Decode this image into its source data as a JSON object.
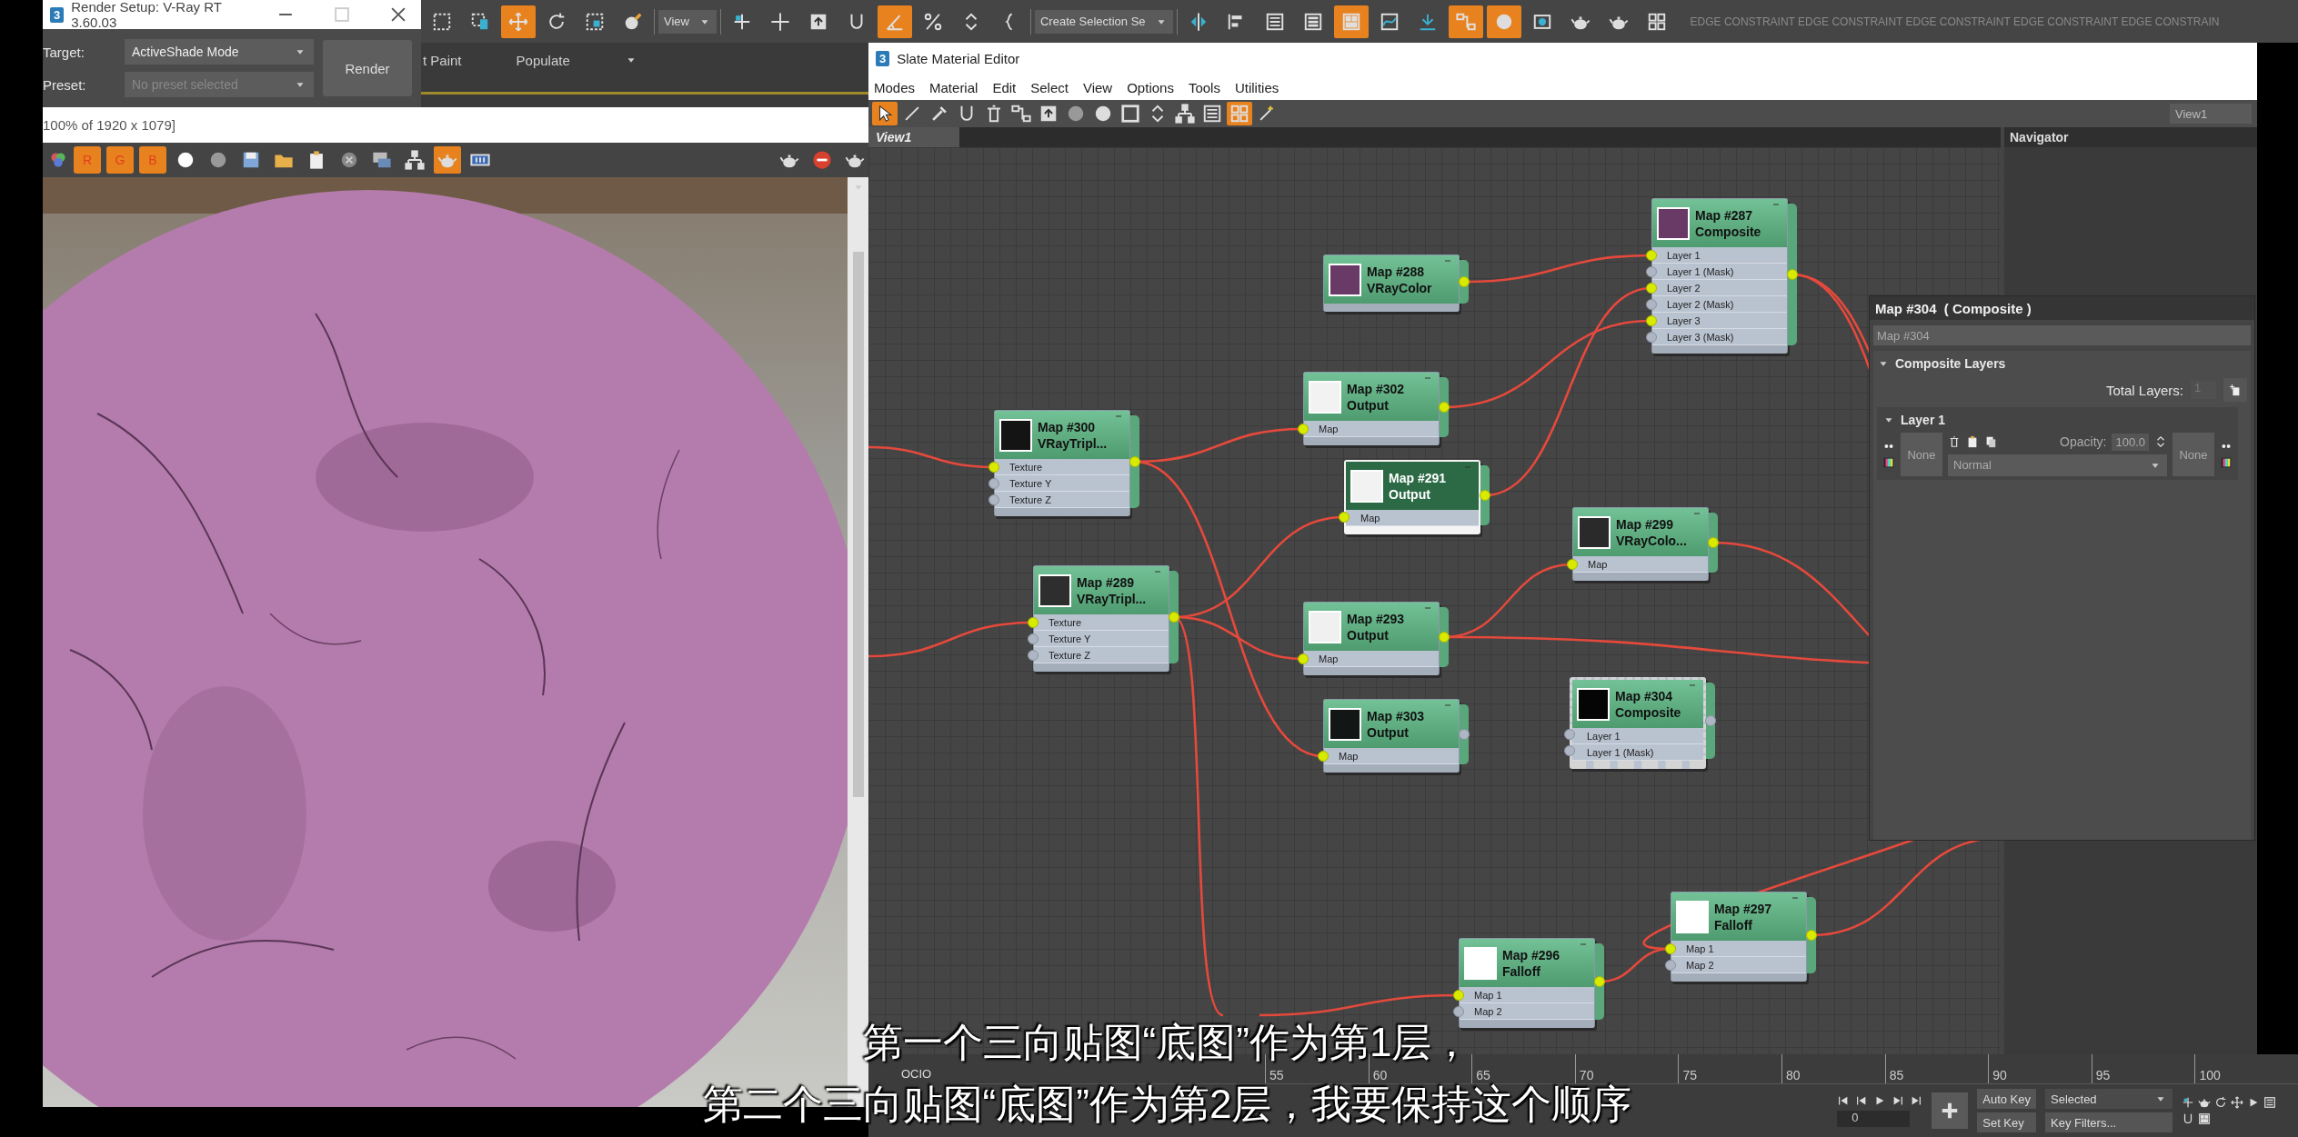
{
  "render_setup": {
    "logo": "3",
    "title": "Render Setup: V-Ray RT 3.60.03",
    "target_label": "Target:",
    "target": "ActiveShade Mode",
    "preset_label": "Preset:",
    "preset": "No preset selected",
    "preset_disabled": true,
    "render_button": "Render"
  },
  "background_tabs": [
    "t Paint",
    "Populate"
  ],
  "main_toolbar": [
    {
      "kind": "tool",
      "active": false
    },
    {
      "kind": "tool",
      "active": false
    },
    {
      "kind": "tool",
      "active": true
    },
    {
      "kind": "tool",
      "active": false
    },
    {
      "kind": "tool",
      "active": false
    },
    {
      "kind": "tool",
      "active": false
    },
    {
      "kind": "dropdown",
      "value": "View"
    },
    {
      "kind": "tool",
      "active": false
    },
    {
      "kind": "tool",
      "active": false
    },
    {
      "kind": "tool",
      "active": false
    },
    {
      "kind": "tool",
      "active": false
    },
    {
      "kind": "tool",
      "active": true
    },
    {
      "kind": "tool",
      "active": false
    },
    {
      "kind": "tool",
      "active": false
    },
    {
      "kind": "tool",
      "active": false
    },
    {
      "kind": "dropdown",
      "value": "Create Selection Se"
    },
    {
      "kind": "tool",
      "active": false
    },
    {
      "kind": "tool",
      "active": false
    },
    {
      "kind": "tool",
      "active": false
    },
    {
      "kind": "tool",
      "active": false
    },
    {
      "kind": "tool",
      "active": true
    },
    {
      "kind": "tool",
      "active": false
    },
    {
      "kind": "tool",
      "active": false
    },
    {
      "kind": "tool",
      "active": true
    },
    {
      "kind": "tool",
      "active": true
    },
    {
      "kind": "tool",
      "active": false
    },
    {
      "kind": "tool",
      "active": false
    },
    {
      "kind": "tool",
      "active": false
    },
    {
      "kind": "tool",
      "active": false
    },
    {
      "kind": "label",
      "text": "EDGE CONSTRAINT EDGE CONSTRAINT EDGE CONSTRAINT EDGE CONSTRAINT EDGE CONSTRAIN"
    }
  ],
  "frame_window": {
    "resolution": "100% of 1920 x 1079]",
    "channels": [
      {
        "label": "R",
        "on": true
      },
      {
        "label": "G",
        "on": true
      },
      {
        "label": "B",
        "on": true
      }
    ],
    "tools": [
      {
        "active": false
      },
      {
        "active": false
      },
      {
        "active": false
      },
      {
        "active": false
      },
      {
        "active": false
      },
      {
        "active": false
      },
      {
        "active": false
      },
      {
        "active": false
      },
      {
        "active": true
      },
      {
        "active": false
      }
    ],
    "right_tools": [
      {
        "active": false
      },
      {
        "active": false
      },
      {
        "active": false
      }
    ]
  },
  "slate_editor": {
    "logo": "3",
    "title": "Slate Material Editor",
    "menus": [
      "Modes",
      "Material",
      "Edit",
      "Select",
      "View",
      "Options",
      "Tools",
      "Utilities"
    ],
    "tools": [
      {
        "active": true
      },
      {
        "active": false
      },
      {
        "active": false
      },
      {
        "active": false
      },
      {
        "active": false
      },
      {
        "active": false
      },
      {
        "active": false
      },
      {
        "active": false
      },
      {
        "active": false
      },
      {
        "active": false
      },
      {
        "active": false
      },
      {
        "active": false
      },
      {
        "active": false
      },
      {
        "active": true
      },
      {
        "active": false
      }
    ],
    "view_select": "View1",
    "tab": {
      "label": "View1",
      "selected": true
    },
    "navigator": "Navigator",
    "nodes": [
      {
        "title": "Map #288",
        "type": "VRayColor",
        "color": "#6a3a66",
        "selected": false,
        "in_panel": false,
        "output_connected": true
      },
      {
        "title": "Map #287",
        "type": "Composite",
        "color": "#6a3a66",
        "selected": false,
        "in_panel": false,
        "output_connected": true,
        "ports": [
          {
            "label": "Layer 1",
            "connected": true
          },
          {
            "label": "Layer 1 (Mask)",
            "connected": false
          },
          {
            "label": "Layer 2",
            "connected": true
          },
          {
            "label": "Layer 2 (Mask)",
            "connected": false
          },
          {
            "label": "Layer 3",
            "connected": true
          },
          {
            "label": "Layer 3 (Mask)",
            "connected": false
          }
        ]
      },
      {
        "title": "Map #300",
        "type": "VRayTripl...",
        "color": "#141414",
        "selected": false,
        "in_panel": false,
        "output_connected": true,
        "ports": [
          {
            "label": "Texture",
            "connected": true
          },
          {
            "label": "Texture Y",
            "connected": false
          },
          {
            "label": "Texture Z",
            "connected": false
          }
        ]
      },
      {
        "title": "Map #302",
        "type": "Output",
        "color": "#f2f2f2",
        "selected": false,
        "in_panel": false,
        "output_connected": true,
        "ports": [
          {
            "label": "Map",
            "connected": true
          }
        ]
      },
      {
        "title": "Map #291",
        "type": "Output",
        "color": "#f2f2f2",
        "selected": true,
        "in_panel": false,
        "output_connected": true,
        "ports": [
          {
            "label": "Map",
            "connected": true
          }
        ]
      },
      {
        "title": "Map #289",
        "type": "VRayTripl...",
        "color": "#2e2e2e",
        "selected": false,
        "in_panel": false,
        "output_connected": true,
        "ports": [
          {
            "label": "Texture",
            "connected": true
          },
          {
            "label": "Texture Y",
            "connected": false
          },
          {
            "label": "Texture Z",
            "connected": false
          }
        ]
      },
      {
        "title": "Map #299",
        "type": "VRayColo...",
        "color": "#2a2a2a",
        "selected": false,
        "in_panel": false,
        "output_connected": true,
        "ports": [
          {
            "label": "Map",
            "connected": true
          }
        ]
      },
      {
        "title": "Map #293",
        "type": "Output",
        "color": "#f0f0f0",
        "selected": false,
        "in_panel": false,
        "output_connected": true,
        "ports": [
          {
            "label": "Map",
            "connected": true
          }
        ]
      },
      {
        "title": "Map #303",
        "type": "Output",
        "color": "#121614",
        "selected": false,
        "in_panel": false,
        "output_connected": false,
        "ports": [
          {
            "label": "Map",
            "connected": true
          }
        ]
      },
      {
        "title": "Map #304",
        "type": "Composite",
        "color": "#050505",
        "selected": false,
        "in_panel": true,
        "output_connected": false,
        "ports": [
          {
            "label": "Layer 1",
            "connected": false
          },
          {
            "label": "Layer 1 (Mask)",
            "connected": false
          }
        ]
      },
      {
        "title": "Map #296",
        "type": "Falloff",
        "color": "#ffffff",
        "selected": false,
        "in_panel": false,
        "output_connected": true,
        "ports": [
          {
            "label": "Map 1",
            "connected": true
          },
          {
            "label": "Map 2",
            "connected": false
          }
        ]
      },
      {
        "title": "Map #297",
        "type": "Falloff",
        "color": "#ffffff",
        "selected": false,
        "in_panel": false,
        "output_connected": true,
        "ports": [
          {
            "label": "Map 1",
            "connected": true
          },
          {
            "label": "Map 2",
            "connected": false
          }
        ]
      }
    ]
  },
  "parameter_panel": {
    "title": "Map #304  ( Composite )",
    "name": "Map #304",
    "rollout": {
      "label": "Composite Layers",
      "expanded": true
    },
    "total_label": "Total Layers:",
    "total": "1",
    "layer": {
      "label": "Layer 1",
      "expanded": true,
      "map": "None",
      "opacity_label": "Opacity:",
      "opacity": "100.0",
      "blend_mode": "Normal",
      "mask": "None"
    }
  },
  "timeline": {
    "ticks": [
      "55",
      "60",
      "65",
      "70",
      "75",
      "80",
      "85",
      "90",
      "95",
      "100"
    ]
  },
  "status": {
    "left": [
      "OCIO"
    ],
    "frame": "0",
    "auto_key": "Auto Key",
    "selection": "Selected",
    "set_key": "Set Key",
    "key_filters": "Key Filters..."
  },
  "subtitles": [
    "第一个三向贴图“底图”作为第1层，",
    "第二个三向贴图“底图”作为第2层，我要保持这个顺序"
  ]
}
